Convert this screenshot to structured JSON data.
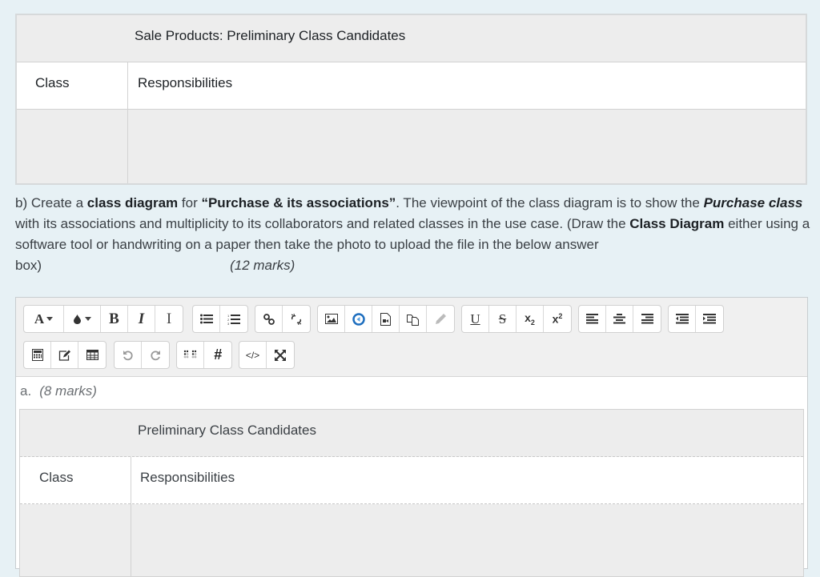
{
  "table1": {
    "title": "Sale Products: Preliminary Class Candidates",
    "col_class": "Class",
    "col_responsibilities": "Responsibilities"
  },
  "question": {
    "prefix": "b) Create a ",
    "bold1": "class diagram",
    "mid1": " for ",
    "bold2": "“Purchase & its associations”",
    "mid2": ". The viewpoint of the class diagram is to show the ",
    "bolditalic": "Purchase class",
    "mid3": " with its associations and multiplicity to its collaborators and related classes in the use case.  (Draw the ",
    "bold3": "Class Diagram",
    "mid4": " either using a software tool or handwriting on a paper then take the photo to upload the file in the below answer",
    "end": "box)",
    "marks": "(12 marks)"
  },
  "editor": {
    "toolbar": {
      "row1": [
        {
          "name": "font-style",
          "icon": "font-A-dropdown-icon"
        },
        {
          "name": "font-color",
          "icon": "color-drop-dropdown-icon"
        },
        {
          "name": "bold",
          "icon": "bold-icon",
          "glyph": "B"
        },
        {
          "name": "italic",
          "icon": "italic-icon",
          "glyph": "I"
        },
        {
          "name": "clear-formatting",
          "icon": "text-cursor-icon"
        },
        {
          "name": "unordered-list",
          "icon": "bullet-list-icon"
        },
        {
          "name": "ordered-list",
          "icon": "numbered-list-icon"
        },
        {
          "name": "link",
          "icon": "link-icon"
        },
        {
          "name": "unlink",
          "icon": "unlink-icon"
        },
        {
          "name": "image",
          "icon": "image-icon"
        },
        {
          "name": "record-audio",
          "icon": "audio-record-icon"
        },
        {
          "name": "media",
          "icon": "media-file-icon"
        },
        {
          "name": "manage-files",
          "icon": "copy-files-icon"
        },
        {
          "name": "draw",
          "icon": "pencil-icon"
        },
        {
          "name": "underline",
          "icon": "underline-icon",
          "glyph": "U"
        },
        {
          "name": "strikethrough",
          "icon": "strikethrough-icon",
          "glyph": "S"
        },
        {
          "name": "subscript",
          "icon": "subscript-icon",
          "glyph": "x₂"
        },
        {
          "name": "superscript",
          "icon": "superscript-icon",
          "glyph": "x²"
        },
        {
          "name": "align-left",
          "icon": "align-left-icon"
        },
        {
          "name": "align-center",
          "icon": "align-center-icon"
        },
        {
          "name": "align-right",
          "icon": "align-right-icon"
        },
        {
          "name": "outdent",
          "icon": "outdent-icon"
        },
        {
          "name": "indent",
          "icon": "indent-icon"
        }
      ],
      "row2": [
        {
          "name": "equation",
          "icon": "calculator-icon"
        },
        {
          "name": "edit-table",
          "icon": "edit-icon"
        },
        {
          "name": "table",
          "icon": "table-icon"
        },
        {
          "name": "undo",
          "icon": "undo-icon"
        },
        {
          "name": "redo",
          "icon": "redo-icon"
        },
        {
          "name": "braille",
          "icon": "braille-icon"
        },
        {
          "name": "accessibility-checker",
          "icon": "hash-icon",
          "glyph": "#"
        },
        {
          "name": "html",
          "icon": "code-icon",
          "glyph": "</>"
        },
        {
          "name": "fullscreen",
          "icon": "expand-icon"
        }
      ]
    },
    "content": {
      "label_prefix": "a.",
      "label_marks": "(8 marks)",
      "table": {
        "title": "Preliminary Class Candidates",
        "col_class": "Class",
        "col_responsibilities": "Responsibilities"
      }
    }
  }
}
